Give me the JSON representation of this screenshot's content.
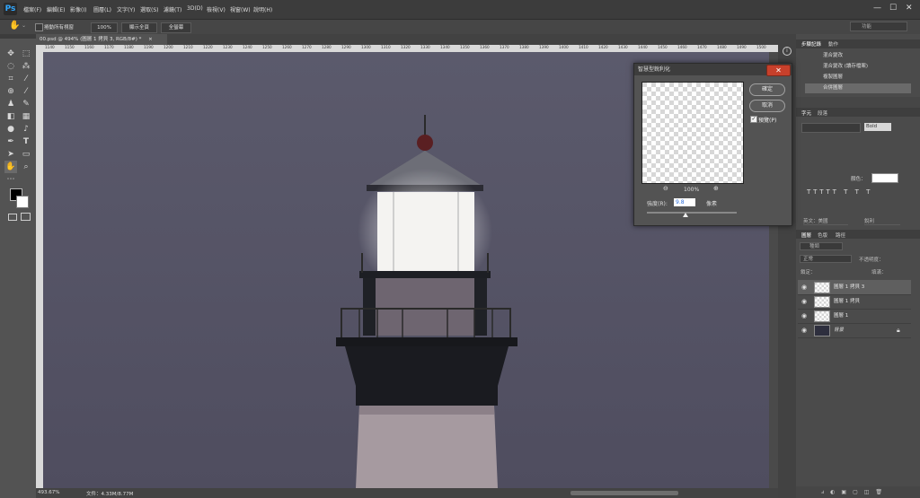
{
  "app": {
    "logo": "Ps"
  },
  "menu": [
    "檔案(F)",
    "編輯(E)",
    "影像(I)",
    "圖層(L)",
    "文字(Y)",
    "選取(S)",
    "濾鏡(T)",
    "3D(D)",
    "檢視(V)",
    "視窗(W)",
    "說明(H)"
  ],
  "window_controls": {
    "minimize": "—",
    "maximize": "☐",
    "close": "✕"
  },
  "options_bar": {
    "scroll_all_label": "捲動所有視窗",
    "zoom": "100%",
    "fit_screen": "顯示全頁",
    "fill_screen": "全螢幕",
    "workspace": "功能"
  },
  "document": {
    "tab_title": "00.psd @ 494% (圖層 1 拷貝 3, RGB/8#) *",
    "close": "×"
  },
  "ruler_ticks": [
    "1140",
    "1150",
    "1160",
    "1170",
    "1180",
    "1190",
    "1200",
    "1210",
    "1220",
    "1230",
    "1240",
    "1250",
    "1260",
    "1270",
    "1280",
    "1290",
    "1300",
    "1310",
    "1320",
    "1330",
    "1340",
    "1350",
    "1360",
    "1370",
    "1380",
    "1390",
    "1400",
    "1410",
    "1420",
    "1430",
    "1440",
    "1450",
    "1460",
    "1470",
    "1480",
    "1490",
    "1500"
  ],
  "status": {
    "zoom": "493.67%",
    "doc_size": "文件：4.33M/8.77M"
  },
  "history_panel": {
    "tabs": [
      "步驟記錄",
      "動作"
    ],
    "items": [
      "混合變改",
      "混合變改 (讀存檔案)",
      "複製圖層",
      "合併圖層"
    ]
  },
  "character_panel": {
    "tabs": [
      "字元",
      "段落"
    ],
    "font_style": "Bold",
    "color_label": "顏色：",
    "lang": "英文：美國",
    "aa": "銳利"
  },
  "layers_panel": {
    "tabs": [
      "圖層",
      "色版",
      "路徑"
    ],
    "kind_filter": "種類",
    "blend_mode": "正常",
    "opacity_label": "不透明度：",
    "lock_label": "鎖定：",
    "fill_label": "填滿：",
    "layers": [
      {
        "name": "圖層 1 拷貝 3",
        "selected": true
      },
      {
        "name": "圖層 1 拷貝",
        "selected": false
      },
      {
        "name": "圖層 1",
        "selected": false
      },
      {
        "name": "背景",
        "selected": false
      }
    ]
  },
  "dialog": {
    "title": "智慧型銳利化",
    "ok": "確定",
    "cancel": "取消",
    "preview_label": "預覽(P)",
    "preview_checked": true,
    "zoom": "100%",
    "radius_label": "強度(R):",
    "radius_value": "9.8",
    "radius_unit": "像素",
    "radius_level": 0.43
  },
  "colors": {
    "accent": "#31a8ff",
    "close_red": "#c7402b"
  }
}
